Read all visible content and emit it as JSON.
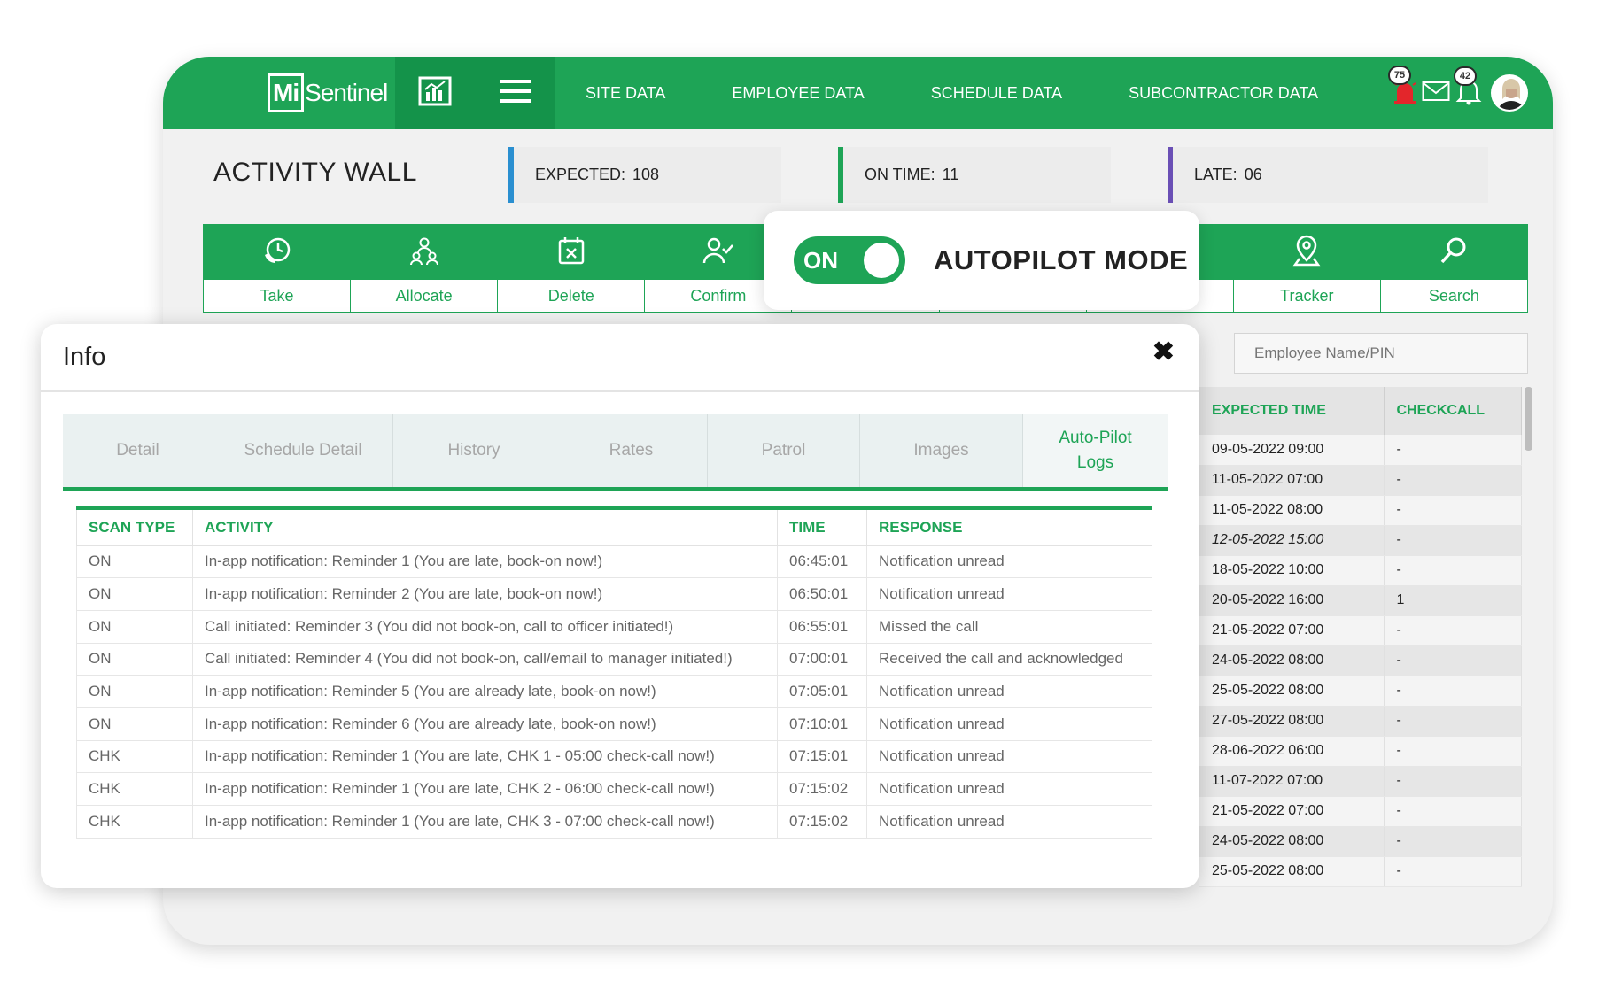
{
  "app": {
    "logo": {
      "mark": "Mi",
      "text": "Sentinel"
    },
    "nav": [
      "SITE DATA",
      "EMPLOYEE DATA",
      "SCHEDULE DATA",
      "SUBCONTRACTOR DATA"
    ],
    "notifications": {
      "alarm_count": "75",
      "bell_count": "42"
    },
    "colors": {
      "brand": "#1ea456",
      "brand_dark": "#14934a",
      "stat_expected": "#2a8fd0",
      "stat_on_time": "#1ea456",
      "stat_late": "#6a4fb5"
    }
  },
  "wall": {
    "title": "ACTIVITY WALL",
    "stats": [
      {
        "label": "EXPECTED:",
        "value": "108"
      },
      {
        "label": "ON TIME:",
        "value": "11"
      },
      {
        "label": "LATE:",
        "value": "06"
      }
    ]
  },
  "toolbar": [
    {
      "label": "Take",
      "icon": "clock-phone-icon"
    },
    {
      "label": "Allocate",
      "icon": "team-allocate-icon"
    },
    {
      "label": "Delete",
      "icon": "calendar-delete-icon"
    },
    {
      "label": "Confirm",
      "icon": "user-check-icon"
    },
    {
      "label": "",
      "icon": ""
    },
    {
      "label": "",
      "icon": ""
    },
    {
      "label": "",
      "icon": ""
    },
    {
      "label": "Tracker",
      "icon": "location-pin-icon"
    },
    {
      "label": "Search",
      "icon": "search-icon"
    }
  ],
  "autopilot": {
    "toggle_label": "ON",
    "title": "AUTOPILOT MODE"
  },
  "employee_search": {
    "placeholder": "Employee Name/PIN"
  },
  "side_table": {
    "headers": [
      "EXPECTED TIME",
      "CHECKCALL"
    ],
    "rows": [
      [
        "09-05-2022 09:00",
        "-"
      ],
      [
        "11-05-2022 07:00",
        "-"
      ],
      [
        "11-05-2022 08:00",
        "-"
      ],
      [
        "12-05-2022 15:00",
        "-"
      ],
      [
        "18-05-2022 10:00",
        "-"
      ],
      [
        "20-05-2022 16:00",
        "1"
      ],
      [
        "21-05-2022 07:00",
        "-"
      ],
      [
        "24-05-2022 08:00",
        "-"
      ],
      [
        "25-05-2022 08:00",
        "-"
      ],
      [
        "27-05-2022 08:00",
        "-"
      ],
      [
        "28-06-2022 06:00",
        "-"
      ],
      [
        "11-07-2022 07:00",
        "-"
      ],
      [
        "21-05-2022 07:00",
        "-"
      ],
      [
        "24-05-2022 08:00",
        "-"
      ],
      [
        "25-05-2022 08:00",
        "-"
      ]
    ]
  },
  "modal": {
    "title": "Info",
    "close": "✖",
    "tabs": [
      "Detail",
      "Schedule Detail",
      "History",
      "Rates",
      "Patrol",
      "Images",
      "Auto-Pilot Logs"
    ],
    "active_tab": "Auto-Pilot Logs",
    "table": {
      "headers": [
        "SCAN TYPE",
        "ACTIVITY",
        "TIME",
        "RESPONSE"
      ],
      "rows": [
        [
          "ON",
          "In-app notification: Reminder 1 (You are late, book-on now!)",
          "06:45:01",
          "Notification unread"
        ],
        [
          "ON",
          "In-app notification: Reminder 2 (You are late, book-on now!)",
          "06:50:01",
          "Notification unread"
        ],
        [
          "ON",
          "Call initiated: Reminder 3 (You did not book-on, call to officer initiated!)",
          "06:55:01",
          "Missed the call"
        ],
        [
          "ON",
          "Call initiated: Reminder 4 (You did not book-on, call/email to manager initiated!)",
          "07:00:01",
          "Received the call and acknowledged"
        ],
        [
          "ON",
          "In-app notification: Reminder 5 (You are already late, book-on now!)",
          "07:05:01",
          "Notification unread"
        ],
        [
          "ON",
          "In-app notification: Reminder 6 (You are already late, book-on now!)",
          "07:10:01",
          "Notification unread"
        ],
        [
          "CHK",
          "In-app notification: Reminder 1 (You are late, CHK 1 - 05:00 check-call now!)",
          "07:15:01",
          "Notification unread"
        ],
        [
          "CHK",
          "In-app notification: Reminder 1 (You are late, CHK 2 - 06:00 check-call now!)",
          "07:15:02",
          "Notification unread"
        ],
        [
          "CHK",
          "In-app notification: Reminder 1 (You are late, CHK 3 - 07:00 check-call now!)",
          "07:15:02",
          "Notification unread"
        ]
      ]
    }
  }
}
